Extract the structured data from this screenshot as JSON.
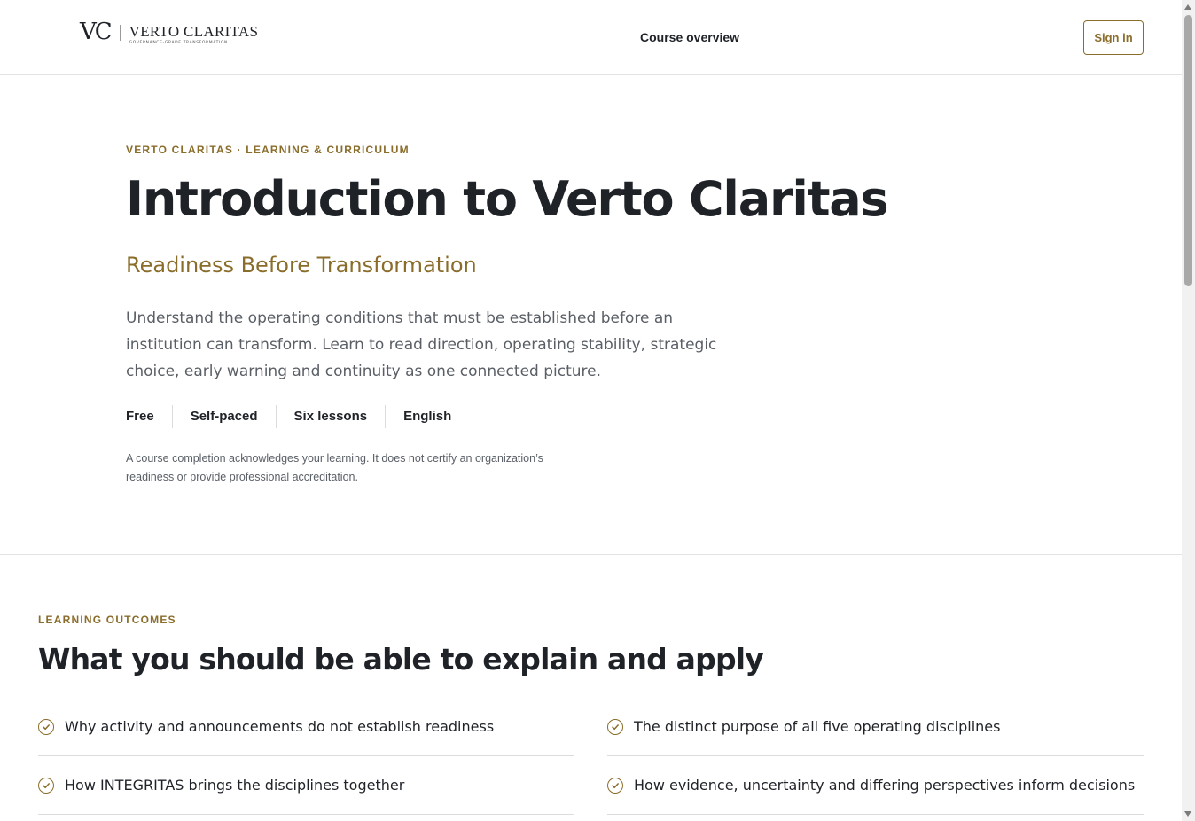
{
  "header": {
    "logo_mark": "VC",
    "logo_name": "VERTO CLARITAS",
    "logo_tagline": "GOVERNANCE-GRADE TRANSFORMATION",
    "nav_link": "Course overview",
    "signin_label": "Sign in"
  },
  "hero": {
    "eyebrow": "VERTO CLARITAS · LEARNING & CURRICULUM",
    "title": "Introduction to Verto Claritas",
    "subtitle": "Readiness Before Transformation",
    "description": "Understand the operating conditions that must be established before an institution can transform. Learn to read direction, operating stability, strategic choice, early warning and continuity as one connected picture.",
    "meta": [
      "Free",
      "Self-paced",
      "Six lessons",
      "English"
    ],
    "disclaimer": "A course completion acknowledges your learning. It does not certify an organization’s readiness or provide professional accreditation."
  },
  "outcomes": {
    "eyebrow": "LEARNING OUTCOMES",
    "title": "What you should be able to explain and apply",
    "items": [
      "Why activity and announcements do not establish readiness",
      "The distinct purpose of all five operating disciplines",
      "How INTEGRITAS brings the disciplines together",
      "How evidence, uncertainty and differing perspectives inform decisions"
    ]
  },
  "colors": {
    "accent": "#8a6d2b",
    "text": "#1f2328",
    "muted": "#5a5f66",
    "divider": "#e3e3e3"
  },
  "icons": {
    "outcome_icon": "check-circle-icon"
  }
}
